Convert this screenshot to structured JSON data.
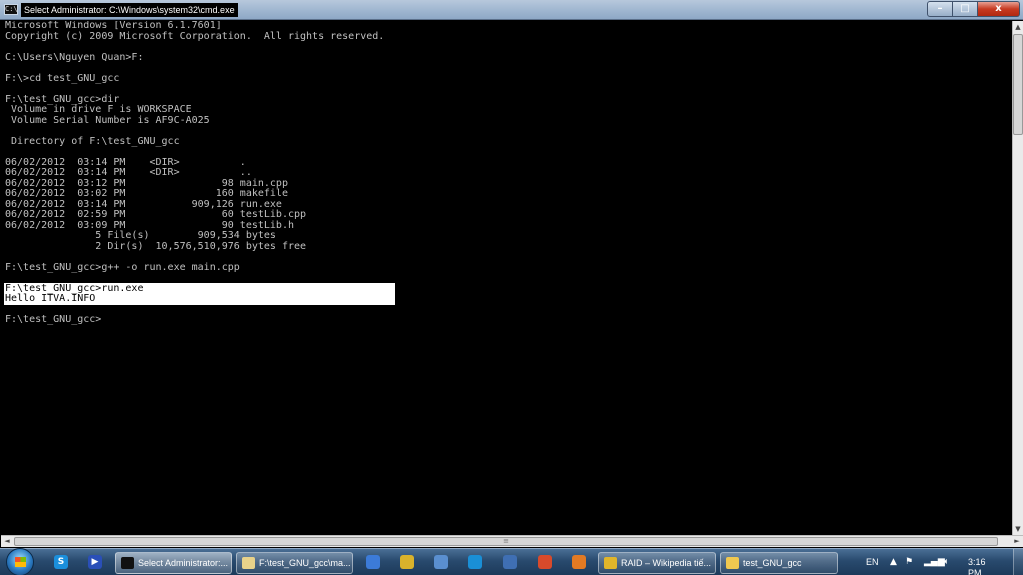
{
  "window": {
    "title": "Select Administrator: C:\\Windows\\system32\\cmd.exe",
    "icon_label": "C:\\",
    "buttons": {
      "minimize": "–",
      "maximize": "□",
      "close": "x"
    }
  },
  "console": {
    "lines": [
      "Microsoft Windows [Version 6.1.7601]",
      "Copyright (c) 2009 Microsoft Corporation.  All rights reserved.",
      "",
      "C:\\Users\\Nguyen Quan>F:",
      "",
      "F:\\>cd test_GNU_gcc",
      "",
      "F:\\test_GNU_gcc>dir",
      " Volume in drive F is WORKSPACE",
      " Volume Serial Number is AF9C-A025",
      "",
      " Directory of F:\\test_GNU_gcc",
      "",
      "06/02/2012  03:14 PM    <DIR>          .",
      "06/02/2012  03:14 PM    <DIR>          ..",
      "06/02/2012  03:12 PM                98 main.cpp",
      "06/02/2012  03:02 PM               160 makefile",
      "06/02/2012  03:14 PM           909,126 run.exe",
      "06/02/2012  02:59 PM                60 testLib.cpp",
      "06/02/2012  03:09 PM                90 testLib.h",
      "               5 File(s)        909,534 bytes",
      "               2 Dir(s)  10,576,510,976 bytes free",
      "",
      "F:\\test_GNU_gcc>g++ -o run.exe main.cpp",
      "",
      "F:\\test_GNU_gcc>run.exe",
      "Hello ITVA.INFO",
      "",
      "F:\\test_GNU_gcc>"
    ]
  },
  "scrollbars": {
    "up": "▲",
    "down": "▼",
    "left": "◄",
    "right": "►",
    "hthumb_grip": "≡"
  },
  "taskbar": {
    "quick_launch": [
      {
        "name": "skype",
        "glyph": "S",
        "color": "#1b8fdc"
      },
      {
        "name": "media-player",
        "glyph": "▶",
        "color": "#2a4fb8"
      }
    ],
    "tasks": [
      {
        "label": "Select Administrator:...",
        "icon": "cmd-icon",
        "color": "#111111",
        "active": true
      },
      {
        "label": "F:\\test_GNU_gcc\\ma...",
        "icon": "notepad-icon",
        "color": "#e8d28a",
        "active": false
      }
    ],
    "pinned": [
      {
        "name": "app-1",
        "color": "#3c7bd8"
      },
      {
        "name": "app-2",
        "color": "#d9b22b"
      },
      {
        "name": "app-3",
        "color": "#5a8fd0"
      },
      {
        "name": "app-4",
        "color": "#1a8fd6"
      },
      {
        "name": "app-5",
        "color": "#3f6fb3"
      },
      {
        "name": "app-6",
        "color": "#d84a2b"
      },
      {
        "name": "app-7",
        "color": "#e27a23"
      }
    ],
    "tasks_right": [
      {
        "label": "RAID – Wikipedia tiế...",
        "icon": "chrome-icon",
        "color": "#e0b52a",
        "active": false
      },
      {
        "label": "test_GNU_gcc",
        "icon": "folder-icon",
        "color": "#f0c850",
        "active": false
      }
    ],
    "tray": {
      "language": "EN",
      "arrow": "▲",
      "clock": "3:16 PM"
    }
  }
}
